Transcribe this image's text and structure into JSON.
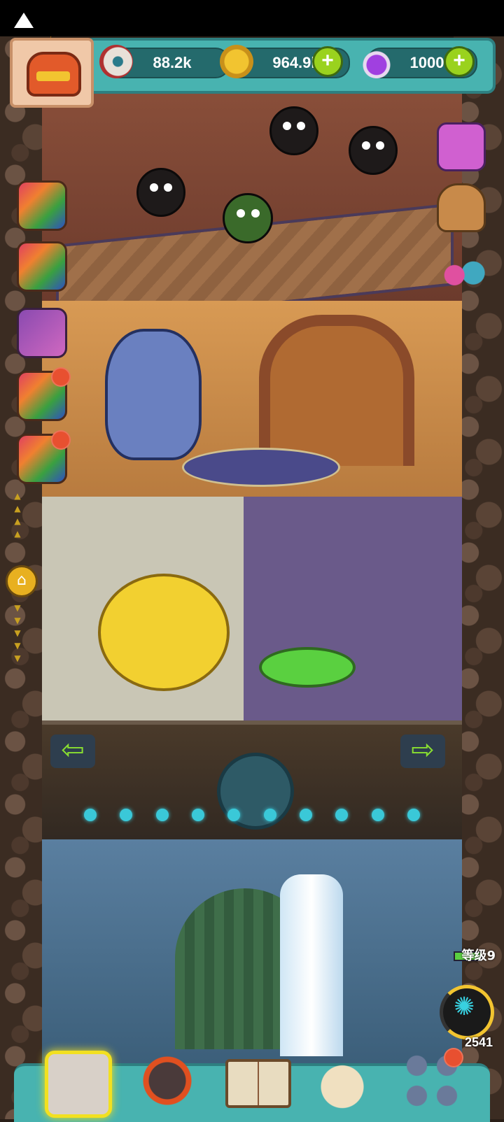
{
  "currencies": {
    "eyeballs": "88.2k",
    "gold": "964.9k",
    "potion": "1000",
    "add_label": "+"
  },
  "sidebar_left": {
    "home_label": "⌂"
  },
  "player": {
    "level_label": "等级9",
    "creature_count": "2541"
  },
  "nav": {
    "left_arrow": "⇦",
    "right_arrow": "⇨"
  }
}
